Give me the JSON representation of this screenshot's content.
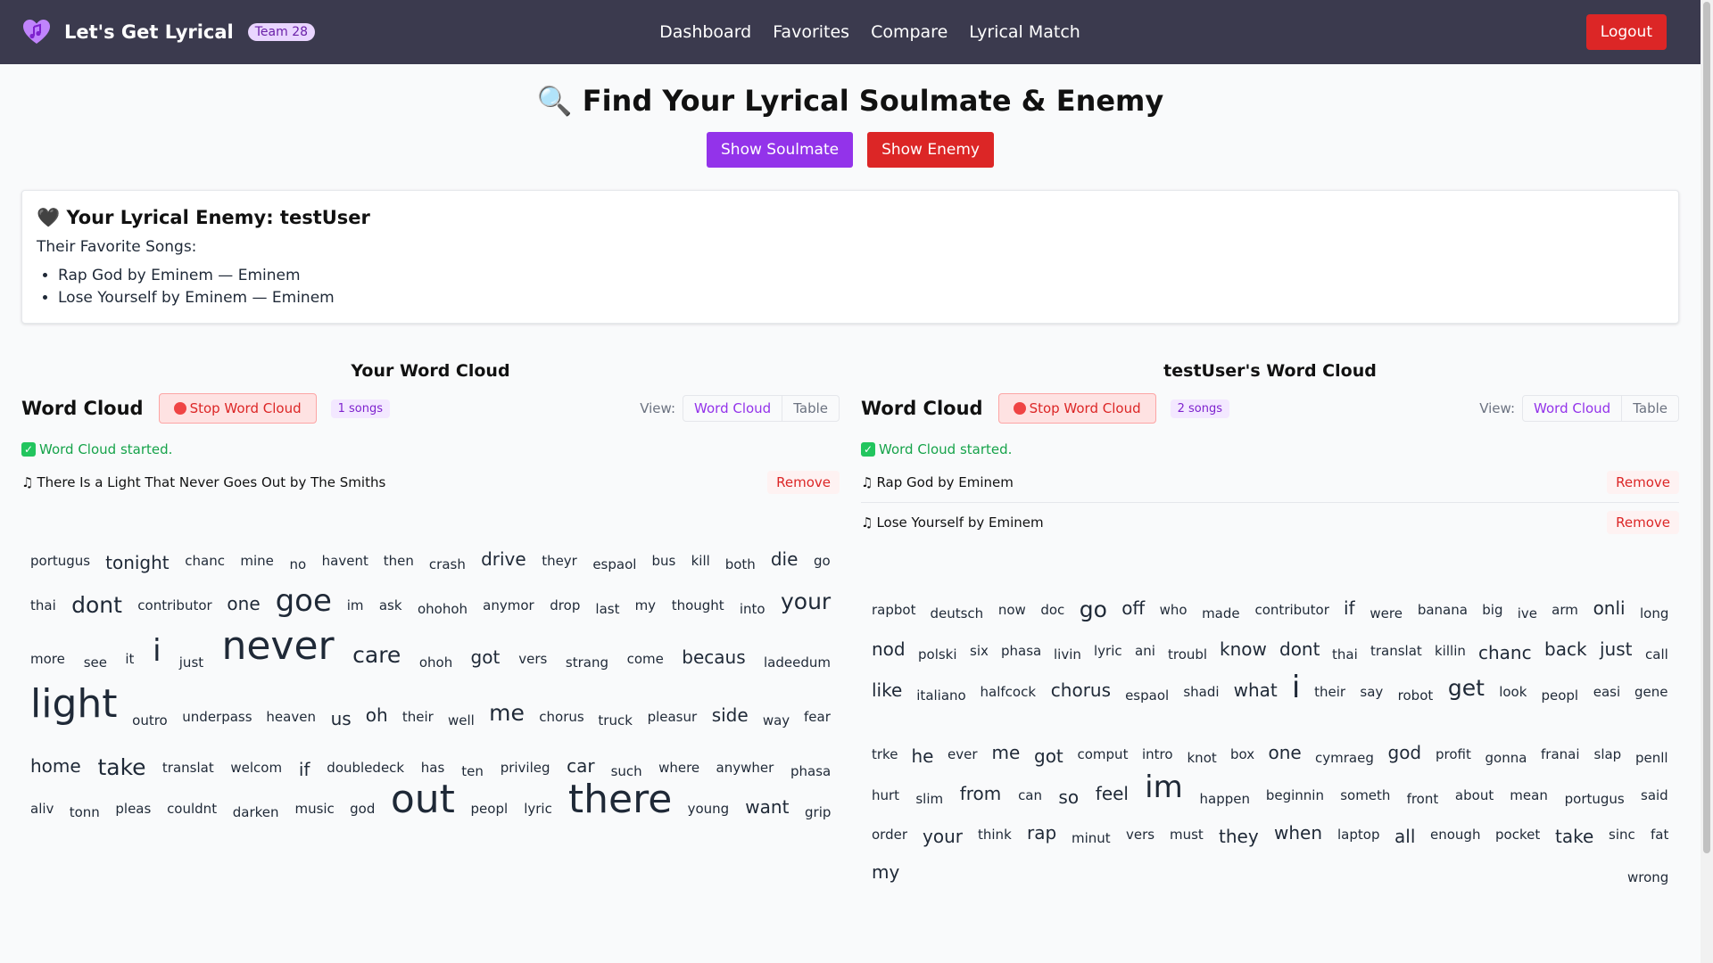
{
  "nav": {
    "brand": "Let's Get Lyrical",
    "team": "Team 28",
    "links": [
      "Dashboard",
      "Favorites",
      "Compare",
      "Lyrical Match"
    ],
    "logout": "Logout"
  },
  "page": {
    "title": "🔍 Find Your Lyrical Soulmate & Enemy",
    "soulmate_btn": "Show Soulmate",
    "enemy_btn": "Show Enemy"
  },
  "enemy": {
    "heading": "🖤 Your Lyrical Enemy: testUser",
    "sub": "Their Favorite Songs:",
    "songs": [
      "Rap God by Eminem — Eminem",
      "Lose Yourself by Eminem — Eminem"
    ]
  },
  "left": {
    "title": "Your Word Cloud",
    "label": "Word Cloud",
    "stop": "Stop Word Cloud",
    "count": "1 songs",
    "view_label": "View:",
    "view_options": [
      "Word Cloud",
      "Table"
    ],
    "status": "Word Cloud started.",
    "songs": [
      "There Is a Light That Never Goes Out by The Smiths"
    ],
    "remove": "Remove",
    "words": [
      [
        "portugus",
        0
      ],
      [
        "tonight",
        1
      ],
      [
        "chanc",
        0
      ],
      [
        "mine",
        0
      ],
      [
        "no",
        0
      ],
      [
        "havent",
        0
      ],
      [
        "then",
        0
      ],
      [
        "crash",
        0
      ],
      [
        "drive",
        1
      ],
      [
        "theyr",
        0
      ],
      [
        "espaol",
        0
      ],
      [
        "bus",
        0
      ],
      [
        "kill",
        0
      ],
      [
        "both",
        0
      ],
      [
        "die",
        1
      ],
      [
        "go",
        0
      ],
      [
        "thai",
        0
      ],
      [
        "dont",
        2
      ],
      [
        "contributor",
        0
      ],
      [
        "one",
        1
      ],
      [
        "goe",
        3
      ],
      [
        "im",
        0
      ],
      [
        "ask",
        0
      ],
      [
        "ohohoh",
        0
      ],
      [
        "anymor",
        0
      ],
      [
        "drop",
        0
      ],
      [
        "last",
        0
      ],
      [
        "my",
        0
      ],
      [
        "thought",
        0
      ],
      [
        "into",
        0
      ],
      [
        "your",
        2
      ],
      [
        "more",
        0
      ],
      [
        "see",
        0
      ],
      [
        "it",
        0
      ],
      [
        "i",
        3
      ],
      [
        "just",
        0
      ],
      [
        "never",
        4
      ],
      [
        "care",
        2
      ],
      [
        "ohoh",
        0
      ],
      [
        "got",
        1
      ],
      [
        "vers",
        0
      ],
      [
        "strang",
        0
      ],
      [
        "come",
        0
      ],
      [
        "becaus",
        1
      ],
      [
        "ladeedum",
        0
      ],
      [
        "light",
        4
      ],
      [
        "outro",
        0
      ],
      [
        "underpass",
        0
      ],
      [
        "heaven",
        0
      ],
      [
        "us",
        1
      ],
      [
        "oh",
        1
      ],
      [
        "their",
        0
      ],
      [
        "well",
        0
      ],
      [
        "me",
        2
      ],
      [
        "chorus",
        0
      ],
      [
        "truck",
        0
      ],
      [
        "pleasur",
        0
      ],
      [
        "side",
        1
      ],
      [
        "way",
        0
      ],
      [
        "fear",
        0
      ],
      [
        "home",
        1
      ],
      [
        "take",
        2
      ],
      [
        "translat",
        0
      ],
      [
        "welcom",
        0
      ],
      [
        "if",
        1
      ],
      [
        "doubledeck",
        0
      ],
      [
        "has",
        0
      ],
      [
        "ten",
        0
      ],
      [
        "privileg",
        0
      ],
      [
        "car",
        1
      ],
      [
        "such",
        0
      ],
      [
        "where",
        0
      ],
      [
        "anywher",
        0
      ],
      [
        "phasa",
        0
      ],
      [
        "aliv",
        0
      ],
      [
        "tonn",
        0
      ],
      [
        "pleas",
        0
      ],
      [
        "couldnt",
        0
      ],
      [
        "darken",
        0
      ],
      [
        "music",
        0
      ],
      [
        "god",
        0
      ],
      [
        "out",
        4
      ],
      [
        "peopl",
        0
      ],
      [
        "lyric",
        0
      ],
      [
        "there",
        4
      ],
      [
        "young",
        0
      ],
      [
        "want",
        1
      ],
      [
        "grip",
        0
      ]
    ]
  },
  "right": {
    "title": "testUser's Word Cloud",
    "label": "Word Cloud",
    "stop": "Stop Word Cloud",
    "count": "2 songs",
    "view_label": "View:",
    "view_options": [
      "Word Cloud",
      "Table"
    ],
    "status": "Word Cloud started.",
    "songs": [
      "Rap God by Eminem",
      "Lose Yourself by Eminem"
    ],
    "remove": "Remove",
    "words": [
      [
        "rapbot",
        0
      ],
      [
        "deutsch",
        0
      ],
      [
        "now",
        0
      ],
      [
        "doc",
        0
      ],
      [
        "go",
        2
      ],
      [
        "off",
        1
      ],
      [
        "who",
        0
      ],
      [
        "made",
        0
      ],
      [
        "contributor",
        0
      ],
      [
        "if",
        1
      ],
      [
        "were",
        0
      ],
      [
        "banana",
        0
      ],
      [
        "big",
        0
      ],
      [
        "ive",
        0
      ],
      [
        "arm",
        0
      ],
      [
        "onli",
        1
      ],
      [
        "long",
        0
      ],
      [
        "nod",
        1
      ],
      [
        "polski",
        0
      ],
      [
        "six",
        0
      ],
      [
        "phasa",
        0
      ],
      [
        "livin",
        0
      ],
      [
        "lyric",
        0
      ],
      [
        "ani",
        0
      ],
      [
        "troubl",
        0
      ],
      [
        "know",
        1
      ],
      [
        "dont",
        1
      ],
      [
        "thai",
        0
      ],
      [
        "translat",
        0
      ],
      [
        "killin",
        0
      ],
      [
        "chanc",
        1
      ],
      [
        "back",
        1
      ],
      [
        "just",
        1
      ],
      [
        "call",
        0
      ],
      [
        "like",
        1
      ],
      [
        "italiano",
        0
      ],
      [
        "halfcock",
        0
      ],
      [
        "chorus",
        1
      ],
      [
        "espaol",
        0
      ],
      [
        "shadi",
        0
      ],
      [
        "what",
        1
      ],
      [
        "i",
        3
      ],
      [
        "their",
        0
      ],
      [
        "say",
        0
      ],
      [
        "robot",
        0
      ],
      [
        "get",
        2
      ],
      [
        "look",
        0
      ],
      [
        "peopl",
        0
      ],
      [
        "easi",
        0
      ],
      [
        "gene",
        0
      ],
      [
        "trke",
        0
      ],
      [
        "he",
        1
      ],
      [
        "ever",
        0
      ],
      [
        "me",
        1
      ],
      [
        "got",
        1
      ],
      [
        "comput",
        0
      ],
      [
        "intro",
        0
      ],
      [
        "knot",
        0
      ],
      [
        "box",
        0
      ],
      [
        "one",
        1
      ],
      [
        "cymraeg",
        0
      ],
      [
        "god",
        1
      ],
      [
        "profit",
        0
      ],
      [
        "gonna",
        0
      ],
      [
        "franai",
        0
      ],
      [
        "slap",
        0
      ],
      [
        "penll",
        0
      ],
      [
        "hurt",
        0
      ],
      [
        "slim",
        0
      ],
      [
        "from",
        1
      ],
      [
        "can",
        0
      ],
      [
        "so",
        1
      ],
      [
        "feel",
        1
      ],
      [
        "im",
        3
      ],
      [
        "happen",
        0
      ],
      [
        "beginnin",
        0
      ],
      [
        "someth",
        0
      ],
      [
        "front",
        0
      ],
      [
        "about",
        0
      ],
      [
        "mean",
        0
      ],
      [
        "portugus",
        0
      ],
      [
        "said",
        0
      ],
      [
        "order",
        0
      ],
      [
        "your",
        1
      ],
      [
        "think",
        0
      ],
      [
        "rap",
        1
      ],
      [
        "minut",
        0
      ],
      [
        "vers",
        0
      ],
      [
        "must",
        0
      ],
      [
        "they",
        1
      ],
      [
        "when",
        1
      ],
      [
        "laptop",
        0
      ],
      [
        "all",
        1
      ],
      [
        "enough",
        0
      ],
      [
        "pocket",
        0
      ],
      [
        "take",
        1
      ],
      [
        "sinc",
        0
      ],
      [
        "fat",
        0
      ],
      [
        "my",
        1
      ],
      [
        "wrong",
        0
      ]
    ]
  },
  "colors": {
    "nav_bg": "#3b3a4e",
    "purple": "#9333ea",
    "red": "#dc2626",
    "green": "#16a34a"
  }
}
